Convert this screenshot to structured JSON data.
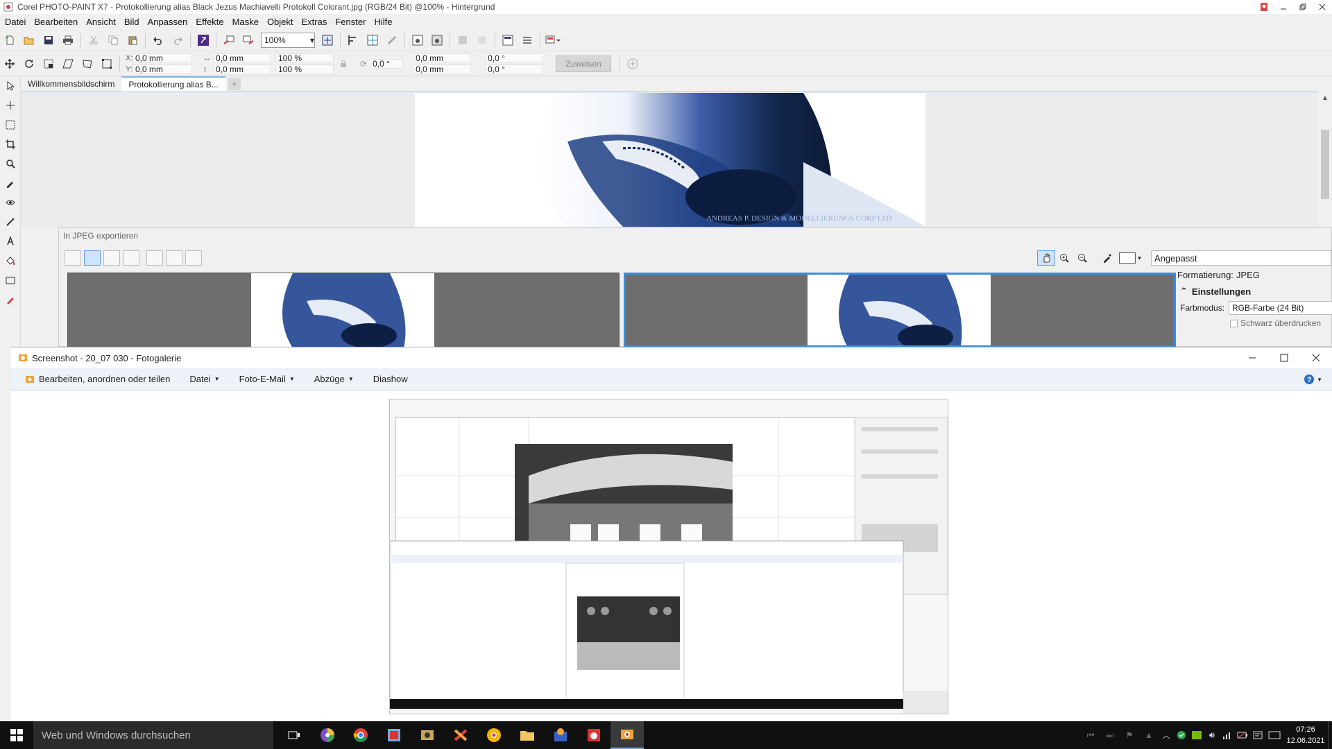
{
  "corel": {
    "title": "Corel PHOTO-PAINT X7 - Protokollierung alias Black Jezus Machiavelli Protokoll Colorant.jpg (RGB/24 Bit) @100% - Hintergrund",
    "menu": [
      "Datei",
      "Bearbeiten",
      "Ansicht",
      "Bild",
      "Anpassen",
      "Effekte",
      "Maske",
      "Objekt",
      "Extras",
      "Fenster",
      "Hilfe"
    ],
    "zoom": "100%",
    "props": {
      "x_label": "X:",
      "x": "0,0 mm",
      "y_label": "Y:",
      "y": "0,0 mm",
      "w": "0,0 mm",
      "h": "0,0 mm",
      "scale_w": "100 %",
      "scale_h": "100 %",
      "rotation": "0,0 °",
      "cx": "0,0 mm",
      "cy": "0,0 mm",
      "skew_h": "0,0 °",
      "skew_v": "0,0 °",
      "assign_btn": "Zuweisen"
    },
    "tabs": [
      "Willkommensbildschirm",
      "Protokollierung alias B..."
    ],
    "watermark": "ANDREAS P. DESIGN & MODELLIERUNGS CORP LTD"
  },
  "export": {
    "title": "In JPEG exportieren",
    "zoom_mode": "Angepasst",
    "format_label": "Formatierung:",
    "format_value": "JPEG",
    "settings_header": "Einstellungen",
    "color_mode_label": "Farbmodus:",
    "color_mode_value": "RGB-Farbe (24 Bit)",
    "overprint_label": "Schwarz überdrucken"
  },
  "gallery": {
    "title": "Screenshot - 20_07 030 - Fotogalerie",
    "menu": {
      "edit": "Bearbeiten, anordnen oder teilen",
      "file": "Datei",
      "email": "Foto-E-Mail",
      "prints": "Abzüge",
      "slideshow": "Diashow"
    }
  },
  "taskbar": {
    "search_placeholder": "Web und Windows durchsuchen",
    "time": "07:26",
    "date": "12.06.2021"
  },
  "colors": {
    "accent": "#3b8de0",
    "taskbar": "#101010",
    "gallery_menu_bg": "#edf2f8"
  },
  "icons": [
    "new-icon",
    "open-icon",
    "save-icon",
    "print-icon",
    "undo-icon",
    "redo-icon",
    "hand-icon",
    "zoom-in-icon",
    "zoom-out-icon",
    "eyedropper-icon",
    "windows-start-icon",
    "task-view-icon",
    "chrome-icon",
    "explorer-icon"
  ]
}
